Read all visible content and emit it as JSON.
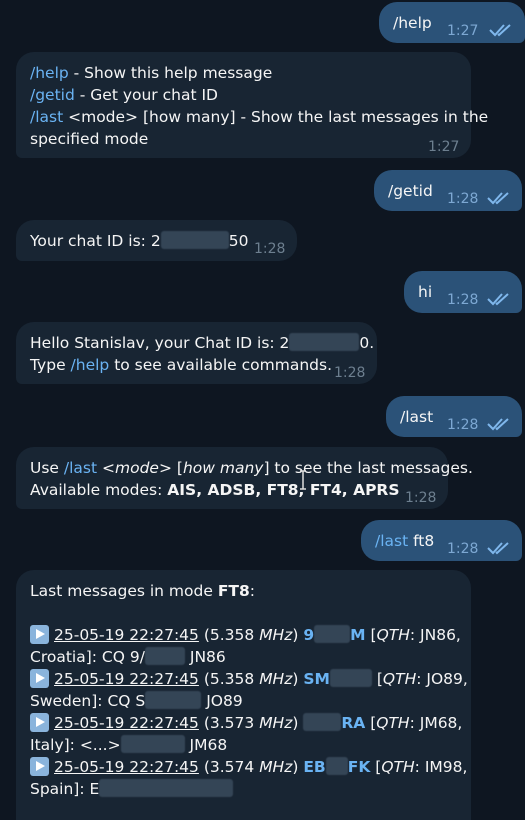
{
  "messages": {
    "m1": {
      "text": "/help",
      "time": "1:27"
    },
    "m2": {
      "l1_cmd": "/help",
      "l1_text": " - Show this help message",
      "l2_cmd": "/getid",
      "l2_text": " - Get your chat ID",
      "l3_cmd": "/last",
      "l3_text": " <mode> [how many] - Show the last messages in the",
      "l4_text": "specified mode",
      "time": "1:27"
    },
    "m3": {
      "text": "/getid",
      "time": "1:28"
    },
    "m4": {
      "pre": "Your chat ID is: 2",
      "post": "50",
      "time": "1:28"
    },
    "m5": {
      "text": "hi",
      "time": "1:28"
    },
    "m6": {
      "l1_pre": "Hello Stanislav, your Chat ID is: 2",
      "l1_post": "0.",
      "l2_pre": "Type ",
      "l2_cmd": "/help",
      "l2_post": " to see available commands.",
      "time": "1:28"
    },
    "m7": {
      "text": "/last",
      "time": "1:28"
    },
    "m8": {
      "l1_pre": "Use ",
      "l1_cmd": "/last",
      "l1_a": " <",
      "l1_mode": "mode",
      "l1_b": "> [",
      "l1_many": "how many",
      "l1_c": "] to see the last messages.",
      "l2_pre": "Available modes: ",
      "l2_modes": "AIS, ADSB, FT8, FT4, APRS",
      "time": "1:28"
    },
    "m9": {
      "cmd": "/last",
      "arg": " ft8",
      "time": "1:28"
    },
    "m10": {
      "title_pre": "Last messages in mode ",
      "title_mode": "FT8",
      "title_post": ":",
      "entries": [
        {
          "ts": "25-05-19 22:27:45",
          "freq_pre": " (5.358 ",
          "unit": "MHz",
          "freq_post": ") ",
          "call_a": "9",
          "call_b": "M",
          "qth_pre": " [",
          "qth_label": "QTH",
          "qth_val": ": JN86,",
          "country": "Croatia]: CQ 9/",
          "msg_post": "JN86"
        },
        {
          "ts": "25-05-19 22:27:45",
          "freq_pre": " (5.358 ",
          "unit": "MHz",
          "freq_post": ") ",
          "call_a": "SM",
          "call_b": "",
          "qth_pre": " [",
          "qth_label": "QTH",
          "qth_val": ": JO89,",
          "country": "Sweden]: CQ S",
          "msg_post": "JO89"
        },
        {
          "ts": "25-05-19 22:27:45",
          "freq_pre": " (3.573 ",
          "unit": "MHz",
          "freq_post": ") ",
          "call_a": "",
          "call_b": "RA",
          "qth_pre": " [",
          "qth_label": "QTH",
          "qth_val": ": JM68,",
          "country": "Italy]: <...>",
          "msg_post": "JM68"
        },
        {
          "ts": "25-05-19 22:27:45",
          "freq_pre": " (3.574 ",
          "unit": "MHz",
          "freq_post": ") ",
          "call_a": "EB",
          "call_b": "FK",
          "qth_pre": " [",
          "qth_label": "QTH",
          "qth_val": ": IM98,",
          "country": "Spain]: E",
          "msg_post": ""
        }
      ]
    }
  },
  "colors": {
    "bg": "#0e1621",
    "out": "#2b5278",
    "in": "#182533",
    "accent": "#6ab3f3"
  }
}
